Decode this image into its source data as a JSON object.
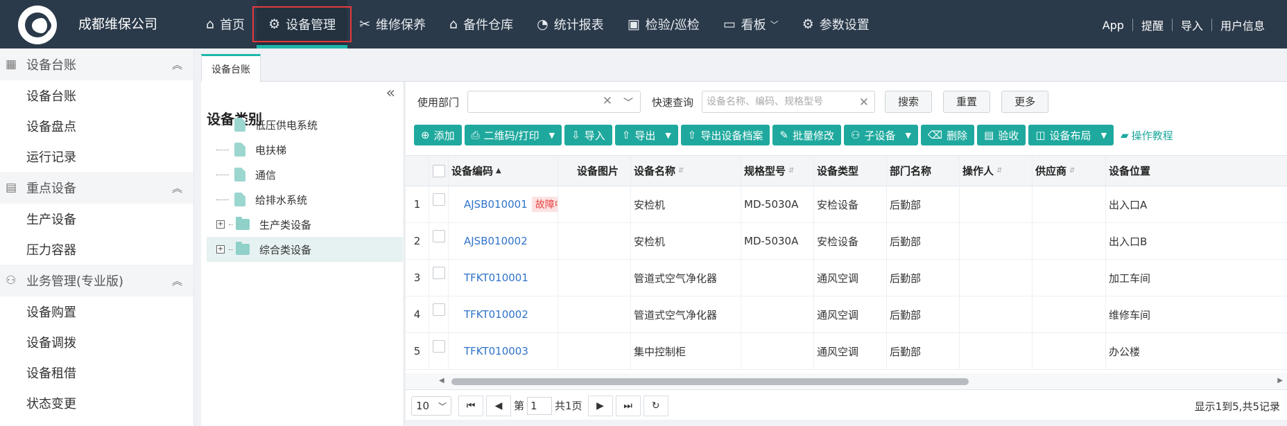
{
  "header": {
    "company": "成都维保公司",
    "nav": [
      {
        "label": "首页",
        "icon": "home-icon",
        "glyph": "⌂"
      },
      {
        "label": "设备管理",
        "icon": "robot-arm-icon",
        "glyph": "⚙",
        "active": true
      },
      {
        "label": "维修保养",
        "icon": "tools-icon",
        "glyph": "✂"
      },
      {
        "label": "备件仓库",
        "icon": "warehouse-icon",
        "glyph": "⌂"
      },
      {
        "label": "统计报表",
        "icon": "pie-chart-icon",
        "glyph": "◔"
      },
      {
        "label": "检验/巡检",
        "icon": "inspection-icon",
        "glyph": "▣"
      },
      {
        "label": "看板",
        "icon": "board-icon",
        "glyph": "▭",
        "caret": true
      },
      {
        "label": "参数设置",
        "icon": "gear-icon",
        "glyph": "⚙"
      }
    ],
    "right": [
      "App",
      "提醒",
      "导入",
      "用户信息"
    ]
  },
  "sidebar": {
    "groups": [
      {
        "label": "设备台账",
        "icon": "ledger-icon",
        "items": [
          "设备台账",
          "设备盘点",
          "运行记录"
        ]
      },
      {
        "label": "重点设备",
        "icon": "key-device-icon",
        "items": [
          "生产设备",
          "压力容器"
        ]
      },
      {
        "label": "业务管理(专业版)",
        "icon": "business-icon",
        "items": [
          "设备购置",
          "设备调拨",
          "设备租借",
          "状态变更"
        ]
      }
    ]
  },
  "tabs": {
    "active": "设备台账"
  },
  "tree": {
    "title": "设备类别",
    "nodes": [
      {
        "label": "低压供电系统",
        "type": "file"
      },
      {
        "label": "电扶梯",
        "type": "file"
      },
      {
        "label": "通信",
        "type": "file"
      },
      {
        "label": "给排水系统",
        "type": "file"
      },
      {
        "label": "生产类设备",
        "type": "folder"
      },
      {
        "label": "综合类设备",
        "type": "folder",
        "selected": true
      }
    ]
  },
  "filter": {
    "dept_label": "使用部门",
    "quick_label": "快速查询",
    "quick_placeholder": "设备名称、编码、规格型号",
    "search": "搜索",
    "reset": "重置",
    "more": "更多"
  },
  "toolbar": {
    "buttons": [
      {
        "label": "添加",
        "icon": "plus-circle-icon",
        "glyph": "⊕"
      },
      {
        "label": "二维码/打印",
        "icon": "print-icon",
        "glyph": "⎙",
        "caret": true
      },
      {
        "label": "导入",
        "icon": "import-icon",
        "glyph": "⇩"
      },
      {
        "label": "导出",
        "icon": "export-icon",
        "glyph": "⇧",
        "caret": true
      },
      {
        "label": "导出设备档案",
        "icon": "export-archive-icon",
        "glyph": "⇧"
      },
      {
        "label": "批量修改",
        "icon": "edit-icon",
        "glyph": "✎"
      },
      {
        "label": "子设备",
        "icon": "sub-device-icon",
        "glyph": "⚇",
        "caret": true
      },
      {
        "label": "删除",
        "icon": "trash-icon",
        "glyph": "🗑"
      },
      {
        "label": "验收",
        "icon": "check-icon",
        "glyph": "▤"
      },
      {
        "label": "设备布局",
        "icon": "layout-icon",
        "glyph": "◫",
        "caret": true
      }
    ],
    "tutorial": "操作教程"
  },
  "grid": {
    "columns": [
      "设备编码",
      "设备图片",
      "设备名称",
      "规格型号",
      "设备类型",
      "部门名称",
      "操作人",
      "供应商",
      "设备位置"
    ],
    "rows": [
      {
        "no": "1",
        "code": "AJSB010001",
        "badge": "故障中",
        "name": "安检机",
        "model": "MD-5030A",
        "type": "安检设备",
        "dept": "后勤部",
        "operator": "",
        "supplier": "",
        "location": "出入口A"
      },
      {
        "no": "2",
        "code": "AJSB010002",
        "badge": "",
        "name": "安检机",
        "model": "MD-5030A",
        "type": "安检设备",
        "dept": "后勤部",
        "operator": "",
        "supplier": "",
        "location": "出入口B"
      },
      {
        "no": "3",
        "code": "TFKT010001",
        "badge": "",
        "name": "管道式空气净化器",
        "model": "",
        "type": "通风空调",
        "dept": "后勤部",
        "operator": "",
        "supplier": "",
        "location": "加工车间"
      },
      {
        "no": "4",
        "code": "TFKT010002",
        "badge": "",
        "name": "管道式空气净化器",
        "model": "",
        "type": "通风空调",
        "dept": "后勤部",
        "operator": "",
        "supplier": "",
        "location": "维修车间"
      },
      {
        "no": "5",
        "code": "TFKT010003",
        "badge": "",
        "name": "集中控制柜",
        "model": "",
        "type": "通风空调",
        "dept": "后勤部",
        "operator": "",
        "supplier": "",
        "location": "办公楼"
      }
    ]
  },
  "pager": {
    "page_size": "10",
    "page_prefix": "第",
    "page": "1",
    "total_pages": "共1页",
    "info": "显示1到5,共5记录"
  }
}
